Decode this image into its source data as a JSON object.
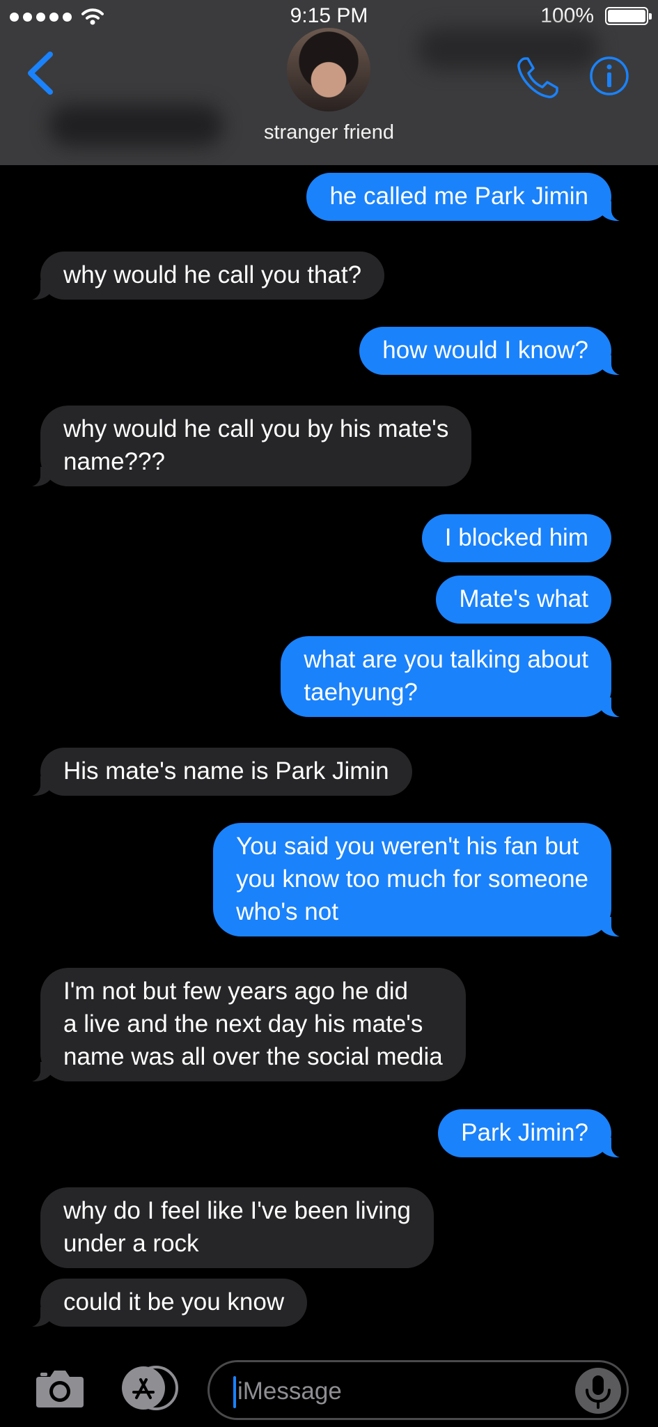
{
  "status_bar": {
    "time": "9:15 PM",
    "battery": "100%"
  },
  "header": {
    "contact_name": "stranger friend"
  },
  "messages": [
    {
      "side": "out",
      "text": "he called me Park Jimin"
    },
    {
      "side": "in",
      "text": "why would he call you that?"
    },
    {
      "side": "out",
      "text": "how would I know?"
    },
    {
      "side": "in",
      "text": "why would he call you by his mate's\nname???"
    },
    {
      "side": "out",
      "text": "I blocked him"
    },
    {
      "side": "out",
      "text": "Mate's what"
    },
    {
      "side": "out",
      "text": "what are you talking about\ntaehyung?"
    },
    {
      "side": "in",
      "text": "His mate's name is Park Jimin"
    },
    {
      "side": "out",
      "text": "You said you weren't his fan but\nyou know too much for someone\nwho's not"
    },
    {
      "side": "in",
      "text": "I'm not but few years ago he did\na live and the next day his mate's\nname was all over the social media"
    },
    {
      "side": "out",
      "text": "Park Jimin?"
    },
    {
      "side": "in",
      "text": "why do I feel like I've been living\nunder a rock"
    },
    {
      "side": "in",
      "text": "could it be you know"
    }
  ],
  "input_bar": {
    "placeholder": "iMessage"
  },
  "colors": {
    "outgoing_bubble": "#1a82fb",
    "incoming_bubble": "#262628",
    "accent": "#1a82fb",
    "header_background": "#3b3b3d"
  },
  "icons": {
    "back": "chevron-left-icon",
    "call": "phone-icon",
    "info": "info-icon",
    "camera": "camera-icon",
    "apps": "app-store-icon",
    "mic": "microphone-icon"
  }
}
